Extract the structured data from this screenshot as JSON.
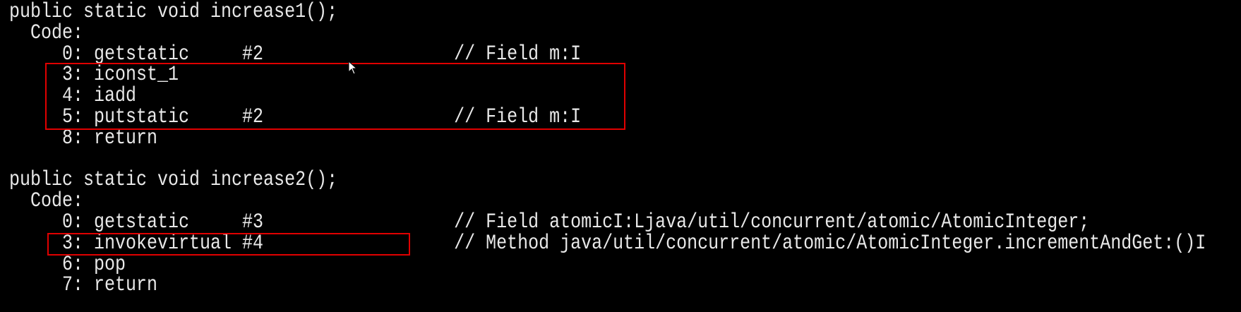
{
  "terminal": {
    "lines": [
      "public static void increase1();",
      "  Code:",
      "     0: getstatic     #2                  // Field m:I",
      "     3: iconst_1",
      "     4: iadd",
      "     5: putstatic     #2                  // Field m:I",
      "     8: return",
      "",
      "public static void increase2();",
      "  Code:",
      "     0: getstatic     #3                  // Field atomicI:Ljava/util/concurrent/atomic/AtomicInteger;",
      "     3: invokevirtual #4                  // Method java/util/concurrent/atomic/AtomicInteger.incrementAndGet:()I",
      "     6: pop",
      "     7: return"
    ]
  },
  "highlight_color": "#e00000",
  "text_color": "#e8e8e8",
  "background_color": "#000000",
  "cursor_icon": "mouse-pointer-icon"
}
